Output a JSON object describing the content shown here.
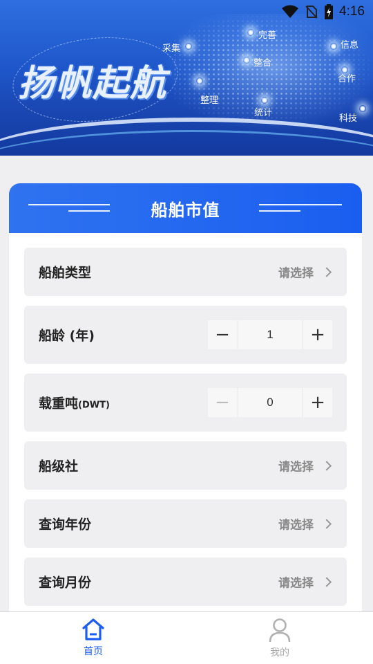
{
  "status_bar": {
    "time": "4:16"
  },
  "banner": {
    "slogan": "扬帆起航",
    "keywords": [
      "采集",
      "整理",
      "统计",
      "整合",
      "完善",
      "信息",
      "合作",
      "科技"
    ]
  },
  "card": {
    "title": "船舶市值",
    "rows": [
      {
        "label": "船舶类型",
        "placeholder": "请选择"
      },
      {
        "label": "船龄 (年)",
        "value": "1",
        "minus": "−",
        "plus": "+"
      },
      {
        "label": "载重吨",
        "label_suffix": "(DWT)",
        "value": "0",
        "minus": "−",
        "plus": "+"
      },
      {
        "label": "船级社",
        "placeholder": "请选择"
      },
      {
        "label": "查询年份",
        "placeholder": "请选择"
      },
      {
        "label": "查询月份",
        "placeholder": "请选择"
      }
    ]
  },
  "tabbar": {
    "tabs": [
      {
        "label": "首页",
        "active": true,
        "icon": "home-icon"
      },
      {
        "label": "我的",
        "active": false,
        "icon": "user-icon"
      }
    ]
  },
  "colors": {
    "primary": "#1a5ef0",
    "row_bg": "#efeff1",
    "page_bg": "#efeff1"
  }
}
